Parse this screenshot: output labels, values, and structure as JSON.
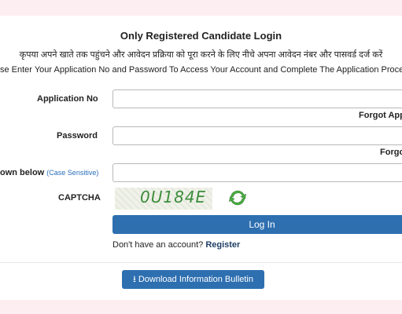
{
  "title": "Only Registered Candidate Login",
  "hindi_instruction": "कृपया अपने खाते तक पहुंचने और आवेदन प्रक्रिया को पूरा करने के लिए नीचे अपना आवेदन नंबर और पासवर्ड दर्ज करें",
  "english_instruction": "se Enter Your Application No and Password To Access Your Account and Complete The Application Process",
  "form": {
    "application_label": "Application No",
    "forgot_application": "Forgot App",
    "password_label": "Password",
    "forgot_password": "Forgo",
    "captcha_input_label": "own below",
    "case_sensitive": "(Case Sensitive)",
    "captcha_label": "CAPTCHA",
    "captcha_text": "0U184E",
    "login_button": "Log In",
    "no_account_text": "Don't have an account?",
    "register_link": "Register",
    "download_button": "Download Information Bulletin"
  },
  "colors": {
    "primary": "#2e6fb0",
    "page_background": "#fdeff1",
    "captcha_text": "#3c8d3c",
    "link": "#2a6ebb"
  },
  "icons": {
    "refresh": "refresh-icon",
    "download": "download-icon"
  }
}
